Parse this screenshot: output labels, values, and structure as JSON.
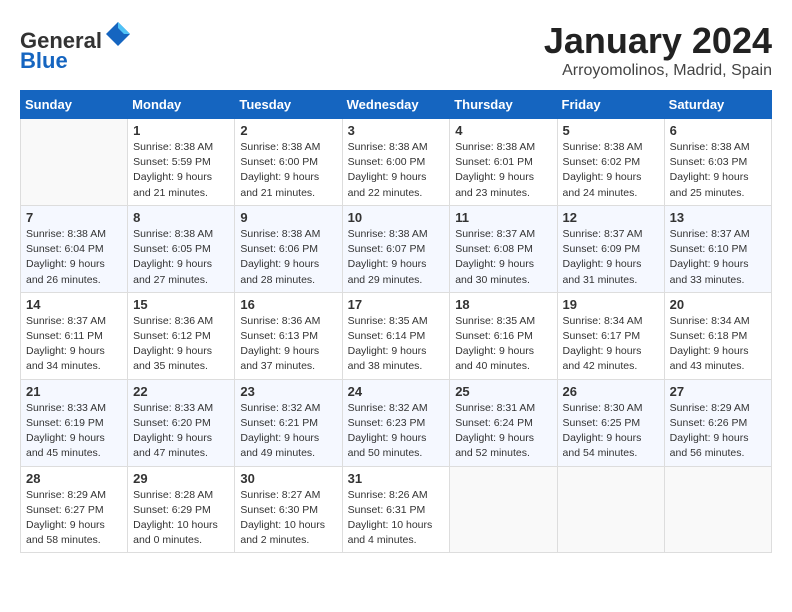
{
  "header": {
    "logo_line1": "General",
    "logo_line2": "Blue",
    "month_title": "January 2024",
    "location": "Arroyomolinos, Madrid, Spain"
  },
  "weekdays": [
    "Sunday",
    "Monday",
    "Tuesday",
    "Wednesday",
    "Thursday",
    "Friday",
    "Saturday"
  ],
  "weeks": [
    [
      {
        "day": "",
        "info": ""
      },
      {
        "day": "1",
        "info": "Sunrise: 8:38 AM\nSunset: 5:59 PM\nDaylight: 9 hours\nand 21 minutes."
      },
      {
        "day": "2",
        "info": "Sunrise: 8:38 AM\nSunset: 6:00 PM\nDaylight: 9 hours\nand 21 minutes."
      },
      {
        "day": "3",
        "info": "Sunrise: 8:38 AM\nSunset: 6:00 PM\nDaylight: 9 hours\nand 22 minutes."
      },
      {
        "day": "4",
        "info": "Sunrise: 8:38 AM\nSunset: 6:01 PM\nDaylight: 9 hours\nand 23 minutes."
      },
      {
        "day": "5",
        "info": "Sunrise: 8:38 AM\nSunset: 6:02 PM\nDaylight: 9 hours\nand 24 minutes."
      },
      {
        "day": "6",
        "info": "Sunrise: 8:38 AM\nSunset: 6:03 PM\nDaylight: 9 hours\nand 25 minutes."
      }
    ],
    [
      {
        "day": "7",
        "info": "Sunrise: 8:38 AM\nSunset: 6:04 PM\nDaylight: 9 hours\nand 26 minutes."
      },
      {
        "day": "8",
        "info": "Sunrise: 8:38 AM\nSunset: 6:05 PM\nDaylight: 9 hours\nand 27 minutes."
      },
      {
        "day": "9",
        "info": "Sunrise: 8:38 AM\nSunset: 6:06 PM\nDaylight: 9 hours\nand 28 minutes."
      },
      {
        "day": "10",
        "info": "Sunrise: 8:38 AM\nSunset: 6:07 PM\nDaylight: 9 hours\nand 29 minutes."
      },
      {
        "day": "11",
        "info": "Sunrise: 8:37 AM\nSunset: 6:08 PM\nDaylight: 9 hours\nand 30 minutes."
      },
      {
        "day": "12",
        "info": "Sunrise: 8:37 AM\nSunset: 6:09 PM\nDaylight: 9 hours\nand 31 minutes."
      },
      {
        "day": "13",
        "info": "Sunrise: 8:37 AM\nSunset: 6:10 PM\nDaylight: 9 hours\nand 33 minutes."
      }
    ],
    [
      {
        "day": "14",
        "info": "Sunrise: 8:37 AM\nSunset: 6:11 PM\nDaylight: 9 hours\nand 34 minutes."
      },
      {
        "day": "15",
        "info": "Sunrise: 8:36 AM\nSunset: 6:12 PM\nDaylight: 9 hours\nand 35 minutes."
      },
      {
        "day": "16",
        "info": "Sunrise: 8:36 AM\nSunset: 6:13 PM\nDaylight: 9 hours\nand 37 minutes."
      },
      {
        "day": "17",
        "info": "Sunrise: 8:35 AM\nSunset: 6:14 PM\nDaylight: 9 hours\nand 38 minutes."
      },
      {
        "day": "18",
        "info": "Sunrise: 8:35 AM\nSunset: 6:16 PM\nDaylight: 9 hours\nand 40 minutes."
      },
      {
        "day": "19",
        "info": "Sunrise: 8:34 AM\nSunset: 6:17 PM\nDaylight: 9 hours\nand 42 minutes."
      },
      {
        "day": "20",
        "info": "Sunrise: 8:34 AM\nSunset: 6:18 PM\nDaylight: 9 hours\nand 43 minutes."
      }
    ],
    [
      {
        "day": "21",
        "info": "Sunrise: 8:33 AM\nSunset: 6:19 PM\nDaylight: 9 hours\nand 45 minutes."
      },
      {
        "day": "22",
        "info": "Sunrise: 8:33 AM\nSunset: 6:20 PM\nDaylight: 9 hours\nand 47 minutes."
      },
      {
        "day": "23",
        "info": "Sunrise: 8:32 AM\nSunset: 6:21 PM\nDaylight: 9 hours\nand 49 minutes."
      },
      {
        "day": "24",
        "info": "Sunrise: 8:32 AM\nSunset: 6:23 PM\nDaylight: 9 hours\nand 50 minutes."
      },
      {
        "day": "25",
        "info": "Sunrise: 8:31 AM\nSunset: 6:24 PM\nDaylight: 9 hours\nand 52 minutes."
      },
      {
        "day": "26",
        "info": "Sunrise: 8:30 AM\nSunset: 6:25 PM\nDaylight: 9 hours\nand 54 minutes."
      },
      {
        "day": "27",
        "info": "Sunrise: 8:29 AM\nSunset: 6:26 PM\nDaylight: 9 hours\nand 56 minutes."
      }
    ],
    [
      {
        "day": "28",
        "info": "Sunrise: 8:29 AM\nSunset: 6:27 PM\nDaylight: 9 hours\nand 58 minutes."
      },
      {
        "day": "29",
        "info": "Sunrise: 8:28 AM\nSunset: 6:29 PM\nDaylight: 10 hours\nand 0 minutes."
      },
      {
        "day": "30",
        "info": "Sunrise: 8:27 AM\nSunset: 6:30 PM\nDaylight: 10 hours\nand 2 minutes."
      },
      {
        "day": "31",
        "info": "Sunrise: 8:26 AM\nSunset: 6:31 PM\nDaylight: 10 hours\nand 4 minutes."
      },
      {
        "day": "",
        "info": ""
      },
      {
        "day": "",
        "info": ""
      },
      {
        "day": "",
        "info": ""
      }
    ]
  ]
}
